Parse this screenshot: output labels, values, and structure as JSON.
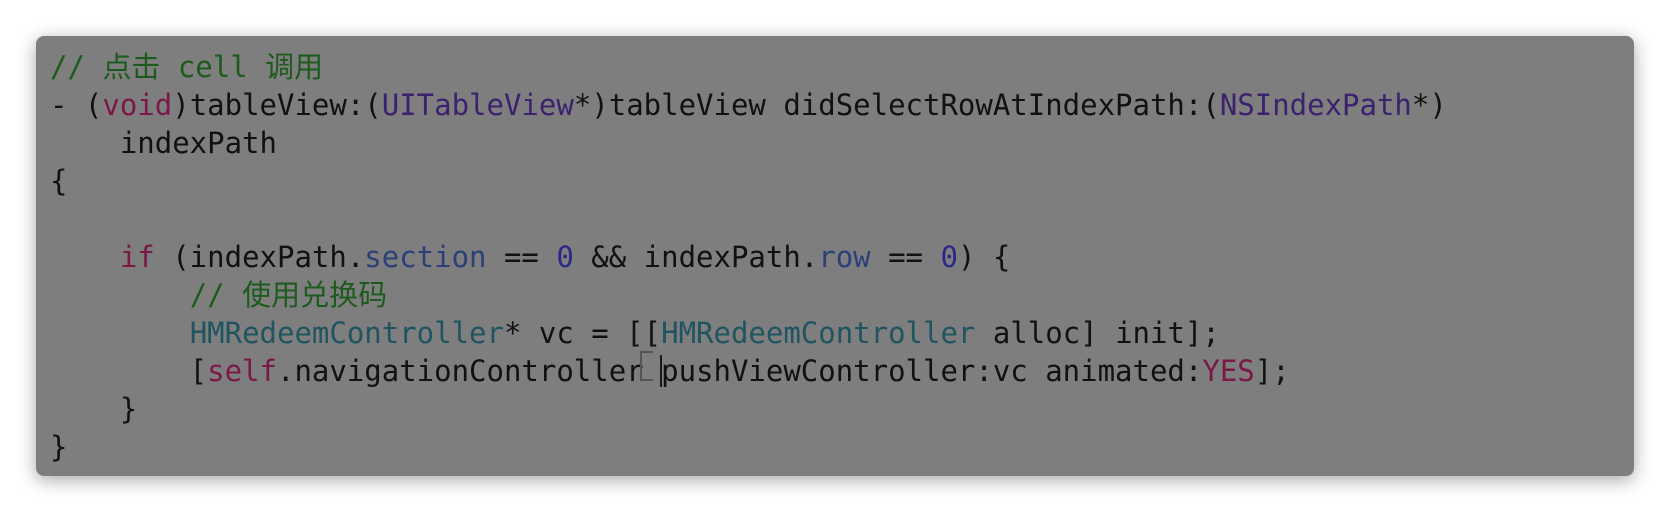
{
  "colors": {
    "background": "#7e7e7e",
    "comment": "#1d5a1d",
    "keyword": "#7a1947",
    "type": "#3c226e",
    "property": "#2b3f78",
    "number": "#2b2888",
    "class": "#1f5460",
    "plain": "#111111"
  },
  "code": {
    "lines": [
      {
        "tokens": [
          {
            "kind": "comment",
            "text": "// 点击 cell 调用"
          }
        ]
      },
      {
        "tokens": [
          {
            "kind": "plain",
            "text": "- ("
          },
          {
            "kind": "keyword",
            "text": "void"
          },
          {
            "kind": "plain",
            "text": ")tableView:("
          },
          {
            "kind": "type",
            "text": "UITableView"
          },
          {
            "kind": "plain",
            "text": "*)tableView didSelectRowAtIndexPath:("
          },
          {
            "kind": "type",
            "text": "NSIndexPath"
          },
          {
            "kind": "plain",
            "text": "*)"
          }
        ]
      },
      {
        "tokens": [
          {
            "kind": "plain",
            "text": "    indexPath"
          }
        ]
      },
      {
        "tokens": [
          {
            "kind": "plain",
            "text": "{"
          }
        ]
      },
      {
        "tokens": [
          {
            "kind": "plain",
            "text": ""
          }
        ]
      },
      {
        "tokens": [
          {
            "kind": "plain",
            "text": "    "
          },
          {
            "kind": "keyword",
            "text": "if"
          },
          {
            "kind": "plain",
            "text": " (indexPath."
          },
          {
            "kind": "prop",
            "text": "section"
          },
          {
            "kind": "plain",
            "text": " == "
          },
          {
            "kind": "number",
            "text": "0"
          },
          {
            "kind": "plain",
            "text": " && indexPath."
          },
          {
            "kind": "prop",
            "text": "row"
          },
          {
            "kind": "plain",
            "text": " == "
          },
          {
            "kind": "number",
            "text": "0"
          },
          {
            "kind": "plain",
            "text": ") {"
          }
        ]
      },
      {
        "tokens": [
          {
            "kind": "plain",
            "text": "        "
          },
          {
            "kind": "comment",
            "text": "// 使用兑换码"
          }
        ]
      },
      {
        "tokens": [
          {
            "kind": "plain",
            "text": "        "
          },
          {
            "kind": "class",
            "text": "HMRedeemController"
          },
          {
            "kind": "plain",
            "text": "* vc = [["
          },
          {
            "kind": "class",
            "text": "HMRedeemController"
          },
          {
            "kind": "plain",
            "text": " alloc] init];"
          }
        ]
      },
      {
        "tokens": [
          {
            "kind": "plain",
            "text": "        ["
          },
          {
            "kind": "keyword",
            "text": "self"
          },
          {
            "kind": "plain",
            "text": ".navigationController"
          },
          {
            "kind": "ibeam",
            "text": ""
          },
          {
            "kind": "plain",
            "text": " "
          },
          {
            "kind": "caret",
            "text": ""
          },
          {
            "kind": "plain",
            "text": "pushViewController:vc animated:"
          },
          {
            "kind": "keyword",
            "text": "YES"
          },
          {
            "kind": "plain",
            "text": "];"
          }
        ]
      },
      {
        "tokens": [
          {
            "kind": "plain",
            "text": "    }"
          }
        ]
      },
      {
        "tokens": [
          {
            "kind": "plain",
            "text": "}"
          }
        ]
      }
    ]
  }
}
